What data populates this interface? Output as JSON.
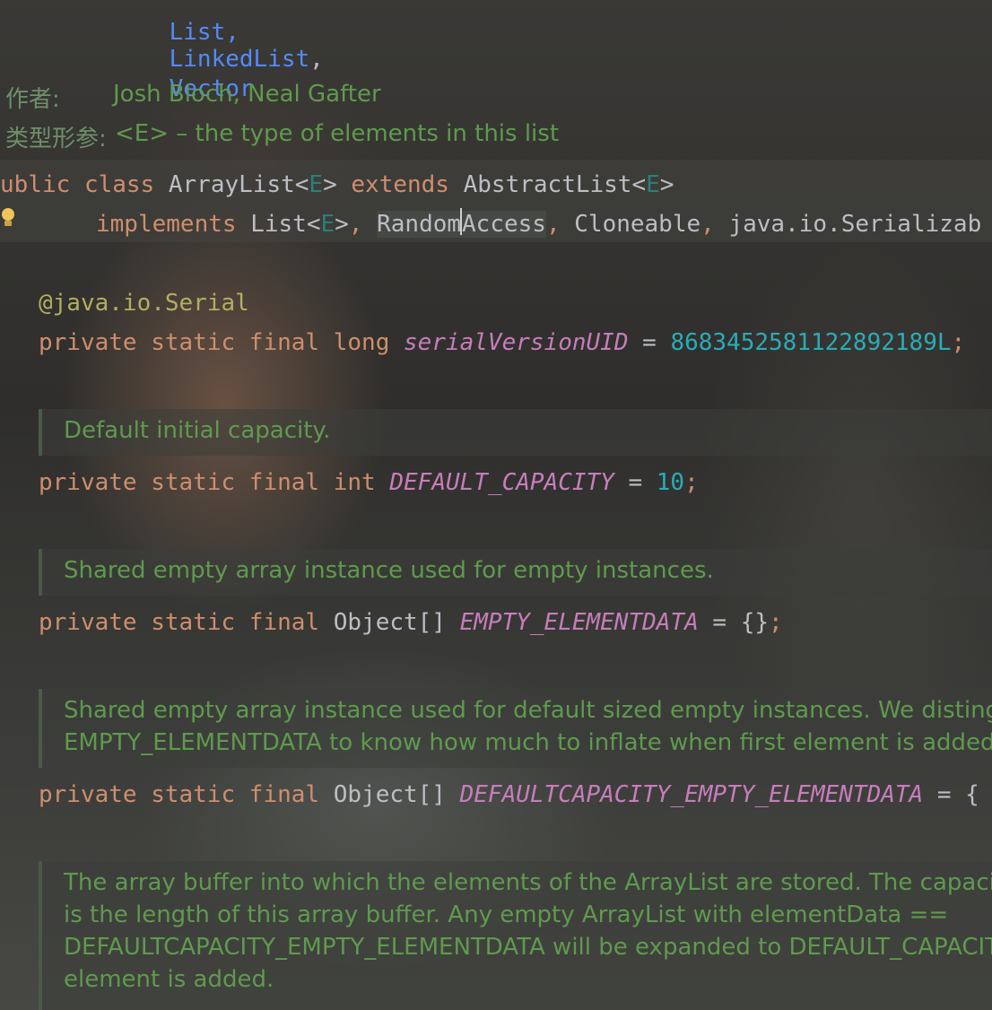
{
  "header_links": {
    "item_linkedlist": "LinkedList",
    "comma": ",",
    "item_vector": "Vector"
  },
  "javadoc_meta": {
    "author_label": "作者:",
    "author_value": "Josh Bloch, Neal Gafter",
    "typeparam_label": "类型形参:",
    "typeparam_value": "<E> – the type of elements in this list"
  },
  "class_decl": {
    "kw_public_partial": "ublic",
    "kw_class": "class",
    "class_name": "ArrayList",
    "type_param": "E",
    "kw_extends": "extends",
    "super_name": "AbstractList",
    "kw_implements": "implements",
    "iface_list": "List",
    "iface_random_pre": "Random",
    "iface_random_post": "Access",
    "iface_cloneable": "Cloneable",
    "iface_serializable": "java.io.Serializab"
  },
  "serial_field": {
    "annotation_pkg": "@java.io.",
    "annotation_name": "Serial",
    "modifiers": "private static final",
    "type": "long",
    "name": "serialVersionUID",
    "value": "8683452581122892189L"
  },
  "doc_default_capacity": "Default initial capacity.",
  "field_default_capacity": {
    "modifiers": "private static final",
    "type": "int",
    "name": "DEFAULT_CAPACITY",
    "value": "10"
  },
  "doc_empty_elementdata": "Shared empty array instance used for empty instances.",
  "field_empty_elementdata": {
    "modifiers": "private static final",
    "type": "Object[]",
    "name": "EMPTY_ELEMENTDATA",
    "value": "{}"
  },
  "doc_default_empty": [
    "Shared empty array instance used for default sized empty instances. We distinguisl",
    "EMPTY_ELEMENTDATA to know how much to inflate when first element is added."
  ],
  "field_default_empty": {
    "modifiers": "private static final",
    "type": "Object[]",
    "name": "DEFAULTCAPACITY_EMPTY_ELEMENTDATA",
    "eq": "= {"
  },
  "doc_element_data": [
    "The array buffer into which the elements of the ArrayList are stored. The capacity o",
    "is the length of this array buffer. Any empty ArrayList with elementData ==",
    "DEFAULTCAPACITY_EMPTY_ELEMENTDATA will be expanded to DEFAULT_CAPACIT",
    "element is added."
  ],
  "icons": {
    "intention": "lightbulb-icon"
  },
  "colors": {
    "keyword": "#cf8e6d",
    "field": "#c77dbb",
    "number": "#2aacb8",
    "doc_comment": "#5f9a4e",
    "annotation": "#b3ae60",
    "link": "#548af7"
  }
}
